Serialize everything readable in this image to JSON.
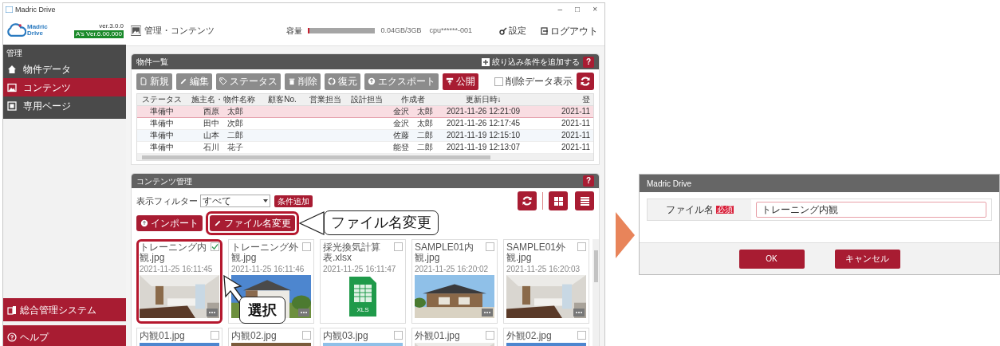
{
  "window": {
    "title": "Madric Drive",
    "controls": [
      "–",
      "□",
      "×"
    ]
  },
  "sidebar": {
    "logo": "Madric Drive",
    "version": "ver.3.0.0",
    "badge": "A's Ver.6.00.000",
    "section": "管理",
    "items": [
      {
        "label": "物件データ",
        "selected": false
      },
      {
        "label": "コンテンツ",
        "selected": true
      },
      {
        "label": "専用ページ",
        "selected": false
      }
    ],
    "bottom_items": [
      {
        "label": "総合管理システム"
      },
      {
        "label": "ヘルプ"
      }
    ]
  },
  "header": {
    "title": "管理・コンテンツ",
    "storage_label": "容量",
    "storage": {
      "level": 0.02
    },
    "storage_text": "0.04GB/3GB",
    "cpu": "cpu******-001",
    "settings": "設定",
    "logout": "ログアウト"
  },
  "property_panel": {
    "title": "物件一覧",
    "add_filter": "絞り込み条件を追加する",
    "help": "?",
    "toolbar": [
      {
        "label": "新規",
        "disabled": true
      },
      {
        "label": "編集",
        "disabled": true
      },
      {
        "label": "ステータス",
        "disabled": true
      },
      {
        "label": "削除",
        "disabled": true
      },
      {
        "label": "復元",
        "disabled": true
      },
      {
        "label": "エクスポート",
        "disabled": true
      },
      {
        "label": "公開",
        "disabled": false
      }
    ],
    "show_deleted": {
      "label": "削除データ表示",
      "checked": false
    },
    "table": {
      "columns": [
        "ステータス",
        "施主名・物件名称",
        "顧客No.",
        "営業担当",
        "設計担当",
        "作成者",
        "更新日時↓",
        "登"
      ],
      "rows": [
        {
          "selected": true,
          "cells": [
            "準備中",
            "西原　太郎",
            "",
            "",
            "",
            "金沢　太郎",
            "2021-11-26 12:21:09",
            "2021-11"
          ]
        },
        {
          "selected": false,
          "cells": [
            "準備中",
            "田中　次郎",
            "",
            "",
            "",
            "金沢　太郎",
            "2021-11-26 12:17:45",
            "2021-11"
          ]
        },
        {
          "selected": false,
          "cells": [
            "準備中",
            "山本　二郎",
            "",
            "",
            "",
            "佐藤　二郎",
            "2021-11-19 12:15:10",
            "2021-11"
          ]
        },
        {
          "selected": false,
          "cells": [
            "準備中",
            "石川　花子",
            "",
            "",
            "",
            "能登　二郎",
            "2021-11-19 12:13:07",
            "2021-11"
          ]
        }
      ]
    }
  },
  "contents_panel": {
    "title": "コンテンツ管理",
    "help": "?",
    "filter_label": "表示フィルター",
    "filter_value": "すべて",
    "add_condition": "条件追加",
    "actions": [
      {
        "label": "インポート",
        "highlighted": false
      },
      {
        "label": "ファイル名変更",
        "highlighted": true
      }
    ],
    "cards": [
      {
        "name": "トレーニング内観.jpg",
        "date": "2021-11-25 16:11:45",
        "kind": "picture",
        "checked": true,
        "highlighted": true
      },
      {
        "name": "トレーニング外観.jpg",
        "date": "2021-11-25 16:11:46",
        "kind": "picture",
        "checked": false,
        "highlighted": false
      },
      {
        "name": "採光換気計算表.xlsx",
        "date": "2021-11-25 16:11:47",
        "kind": "spreadsheet",
        "icon_label": "XLS",
        "checked": false,
        "highlighted": false
      },
      {
        "name": "SAMPLE01内観.jpg",
        "date": "2021-11-25 16:20:02",
        "kind": "picture",
        "checked": false,
        "highlighted": false
      },
      {
        "name": "SAMPLE01外観.jpg",
        "date": "2021-11-25 16:20:03",
        "kind": "picture",
        "checked": false,
        "highlighted": false
      },
      {
        "name": "内観01.jpg",
        "kind": "picture",
        "checked": false,
        "highlighted": false
      },
      {
        "name": "内観02.jpg",
        "kind": "picture",
        "checked": false,
        "highlighted": false
      },
      {
        "name": "内観03.jpg",
        "kind": "picture",
        "checked": false,
        "highlighted": false
      },
      {
        "name": "外観01.jpg",
        "kind": "picture",
        "checked": false,
        "highlighted": false
      },
      {
        "name": "外観02.jpg",
        "kind": "picture",
        "checked": false,
        "highlighted": false
      }
    ]
  },
  "callouts": [
    {
      "text": "ファイル名変更"
    },
    {
      "text": "選択"
    }
  ],
  "dialog": {
    "title": "Madric Drive",
    "field_label": "ファイル名",
    "required": "必須",
    "value": "トレーニング内観",
    "ok": "OK",
    "cancel": "キャンセル"
  }
}
